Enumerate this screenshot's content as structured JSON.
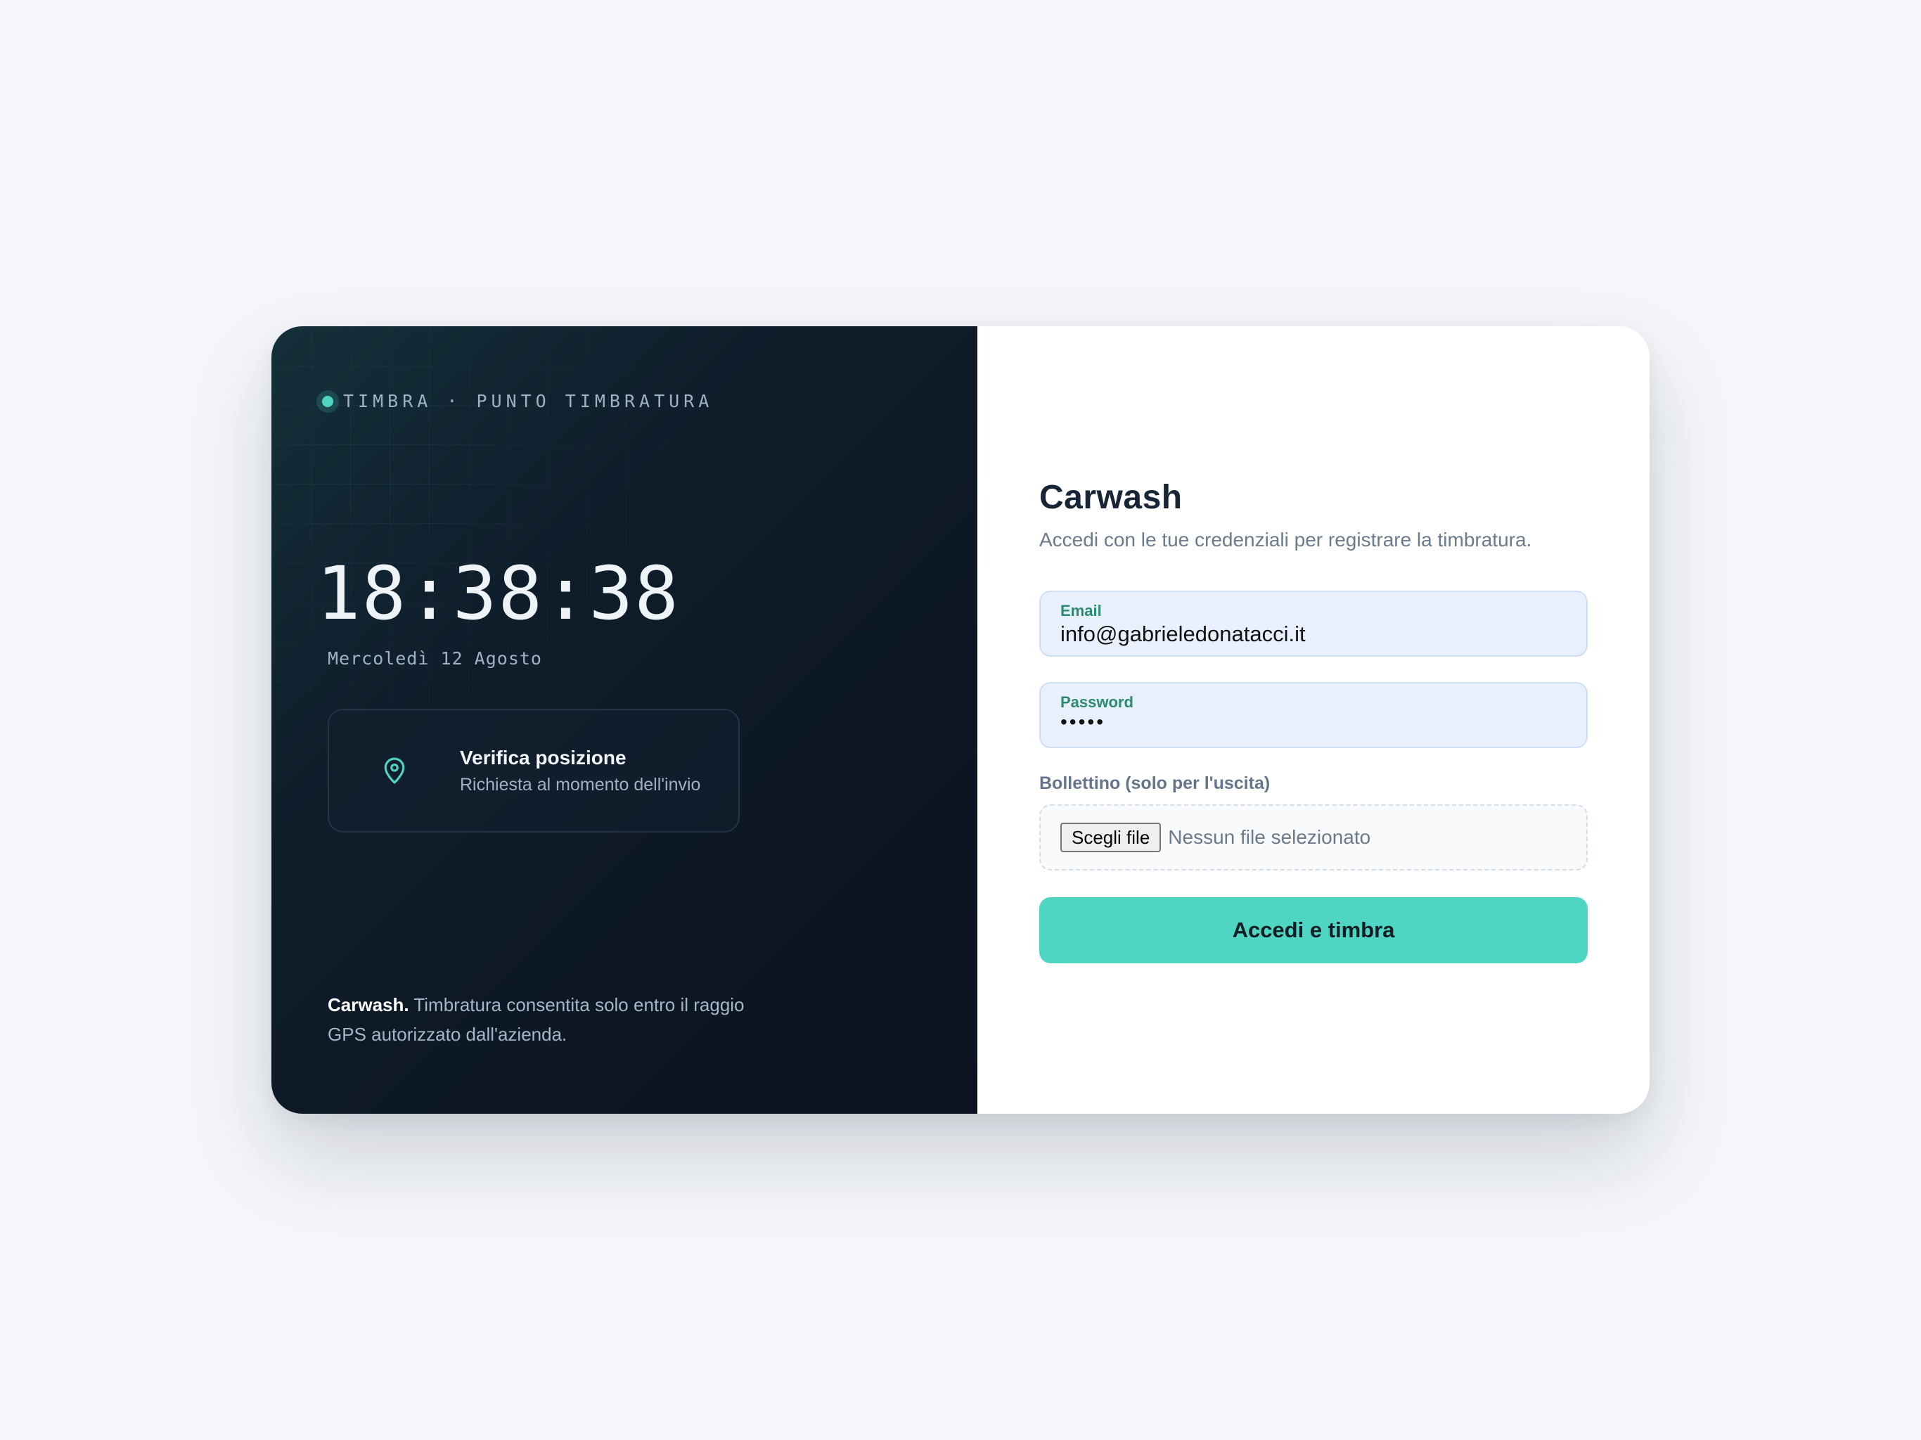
{
  "brand": {
    "text": "TIMBRA · PUNTO TIMBRATURA",
    "status_color": "#4fd6c2"
  },
  "clock": {
    "time": "18:38:38",
    "date": "Mercoledì 12 Agosto"
  },
  "location_card": {
    "icon": "map-pin-icon",
    "title": "Verifica posizione",
    "subtitle": "Richiesta al momento dell'invio"
  },
  "footer": {
    "company": "Carwash.",
    "note": " Timbratura consentita solo entro il raggio GPS autorizzato dall'azienda."
  },
  "form": {
    "title": "Carwash",
    "subtitle": "Accedi con le tue credenziali per registrare la timbratura.",
    "email": {
      "label": "Email",
      "value": "info@gabrieledonatacci.it"
    },
    "password": {
      "label": "Password",
      "masked_value": "•••••"
    },
    "upload": {
      "label": "Bollettino (solo per l'uscita)",
      "button": "Scegli file",
      "status": "Nessun file selezionato"
    },
    "submit_label": "Accedi e timbra"
  },
  "colors": {
    "accent": "#4fd6c2",
    "panel_dark": "#0d1725",
    "field_bg": "#e8f0fe",
    "label_green": "#2b8a6f"
  }
}
